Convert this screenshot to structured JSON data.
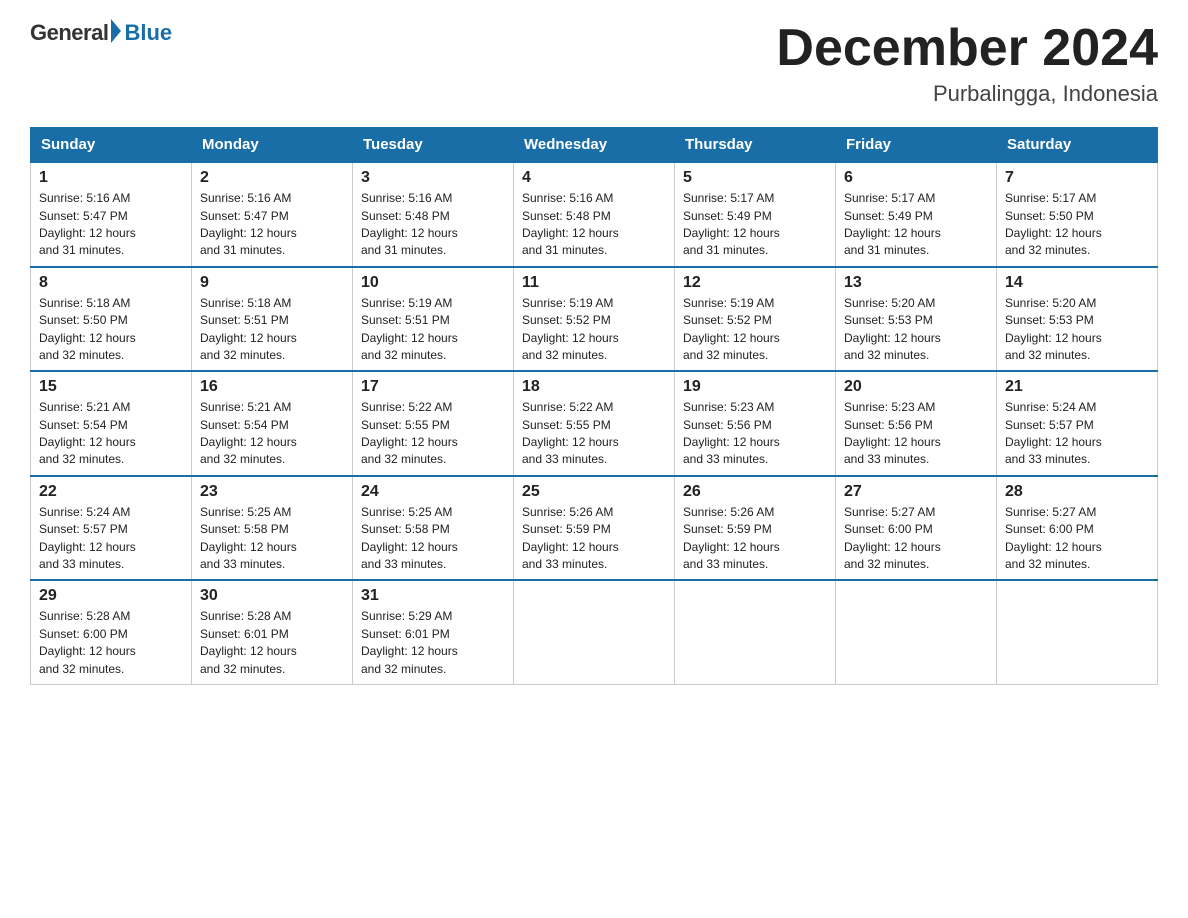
{
  "logo": {
    "general": "General",
    "blue": "Blue"
  },
  "title": "December 2024",
  "subtitle": "Purbalingga, Indonesia",
  "headers": [
    "Sunday",
    "Monday",
    "Tuesday",
    "Wednesday",
    "Thursday",
    "Friday",
    "Saturday"
  ],
  "weeks": [
    [
      {
        "num": "1",
        "info": "Sunrise: 5:16 AM\nSunset: 5:47 PM\nDaylight: 12 hours\nand 31 minutes."
      },
      {
        "num": "2",
        "info": "Sunrise: 5:16 AM\nSunset: 5:47 PM\nDaylight: 12 hours\nand 31 minutes."
      },
      {
        "num": "3",
        "info": "Sunrise: 5:16 AM\nSunset: 5:48 PM\nDaylight: 12 hours\nand 31 minutes."
      },
      {
        "num": "4",
        "info": "Sunrise: 5:16 AM\nSunset: 5:48 PM\nDaylight: 12 hours\nand 31 minutes."
      },
      {
        "num": "5",
        "info": "Sunrise: 5:17 AM\nSunset: 5:49 PM\nDaylight: 12 hours\nand 31 minutes."
      },
      {
        "num": "6",
        "info": "Sunrise: 5:17 AM\nSunset: 5:49 PM\nDaylight: 12 hours\nand 31 minutes."
      },
      {
        "num": "7",
        "info": "Sunrise: 5:17 AM\nSunset: 5:50 PM\nDaylight: 12 hours\nand 32 minutes."
      }
    ],
    [
      {
        "num": "8",
        "info": "Sunrise: 5:18 AM\nSunset: 5:50 PM\nDaylight: 12 hours\nand 32 minutes."
      },
      {
        "num": "9",
        "info": "Sunrise: 5:18 AM\nSunset: 5:51 PM\nDaylight: 12 hours\nand 32 minutes."
      },
      {
        "num": "10",
        "info": "Sunrise: 5:19 AM\nSunset: 5:51 PM\nDaylight: 12 hours\nand 32 minutes."
      },
      {
        "num": "11",
        "info": "Sunrise: 5:19 AM\nSunset: 5:52 PM\nDaylight: 12 hours\nand 32 minutes."
      },
      {
        "num": "12",
        "info": "Sunrise: 5:19 AM\nSunset: 5:52 PM\nDaylight: 12 hours\nand 32 minutes."
      },
      {
        "num": "13",
        "info": "Sunrise: 5:20 AM\nSunset: 5:53 PM\nDaylight: 12 hours\nand 32 minutes."
      },
      {
        "num": "14",
        "info": "Sunrise: 5:20 AM\nSunset: 5:53 PM\nDaylight: 12 hours\nand 32 minutes."
      }
    ],
    [
      {
        "num": "15",
        "info": "Sunrise: 5:21 AM\nSunset: 5:54 PM\nDaylight: 12 hours\nand 32 minutes."
      },
      {
        "num": "16",
        "info": "Sunrise: 5:21 AM\nSunset: 5:54 PM\nDaylight: 12 hours\nand 32 minutes."
      },
      {
        "num": "17",
        "info": "Sunrise: 5:22 AM\nSunset: 5:55 PM\nDaylight: 12 hours\nand 32 minutes."
      },
      {
        "num": "18",
        "info": "Sunrise: 5:22 AM\nSunset: 5:55 PM\nDaylight: 12 hours\nand 33 minutes."
      },
      {
        "num": "19",
        "info": "Sunrise: 5:23 AM\nSunset: 5:56 PM\nDaylight: 12 hours\nand 33 minutes."
      },
      {
        "num": "20",
        "info": "Sunrise: 5:23 AM\nSunset: 5:56 PM\nDaylight: 12 hours\nand 33 minutes."
      },
      {
        "num": "21",
        "info": "Sunrise: 5:24 AM\nSunset: 5:57 PM\nDaylight: 12 hours\nand 33 minutes."
      }
    ],
    [
      {
        "num": "22",
        "info": "Sunrise: 5:24 AM\nSunset: 5:57 PM\nDaylight: 12 hours\nand 33 minutes."
      },
      {
        "num": "23",
        "info": "Sunrise: 5:25 AM\nSunset: 5:58 PM\nDaylight: 12 hours\nand 33 minutes."
      },
      {
        "num": "24",
        "info": "Sunrise: 5:25 AM\nSunset: 5:58 PM\nDaylight: 12 hours\nand 33 minutes."
      },
      {
        "num": "25",
        "info": "Sunrise: 5:26 AM\nSunset: 5:59 PM\nDaylight: 12 hours\nand 33 minutes."
      },
      {
        "num": "26",
        "info": "Sunrise: 5:26 AM\nSunset: 5:59 PM\nDaylight: 12 hours\nand 33 minutes."
      },
      {
        "num": "27",
        "info": "Sunrise: 5:27 AM\nSunset: 6:00 PM\nDaylight: 12 hours\nand 32 minutes."
      },
      {
        "num": "28",
        "info": "Sunrise: 5:27 AM\nSunset: 6:00 PM\nDaylight: 12 hours\nand 32 minutes."
      }
    ],
    [
      {
        "num": "29",
        "info": "Sunrise: 5:28 AM\nSunset: 6:00 PM\nDaylight: 12 hours\nand 32 minutes."
      },
      {
        "num": "30",
        "info": "Sunrise: 5:28 AM\nSunset: 6:01 PM\nDaylight: 12 hours\nand 32 minutes."
      },
      {
        "num": "31",
        "info": "Sunrise: 5:29 AM\nSunset: 6:01 PM\nDaylight: 12 hours\nand 32 minutes."
      },
      {
        "num": "",
        "info": ""
      },
      {
        "num": "",
        "info": ""
      },
      {
        "num": "",
        "info": ""
      },
      {
        "num": "",
        "info": ""
      }
    ]
  ]
}
